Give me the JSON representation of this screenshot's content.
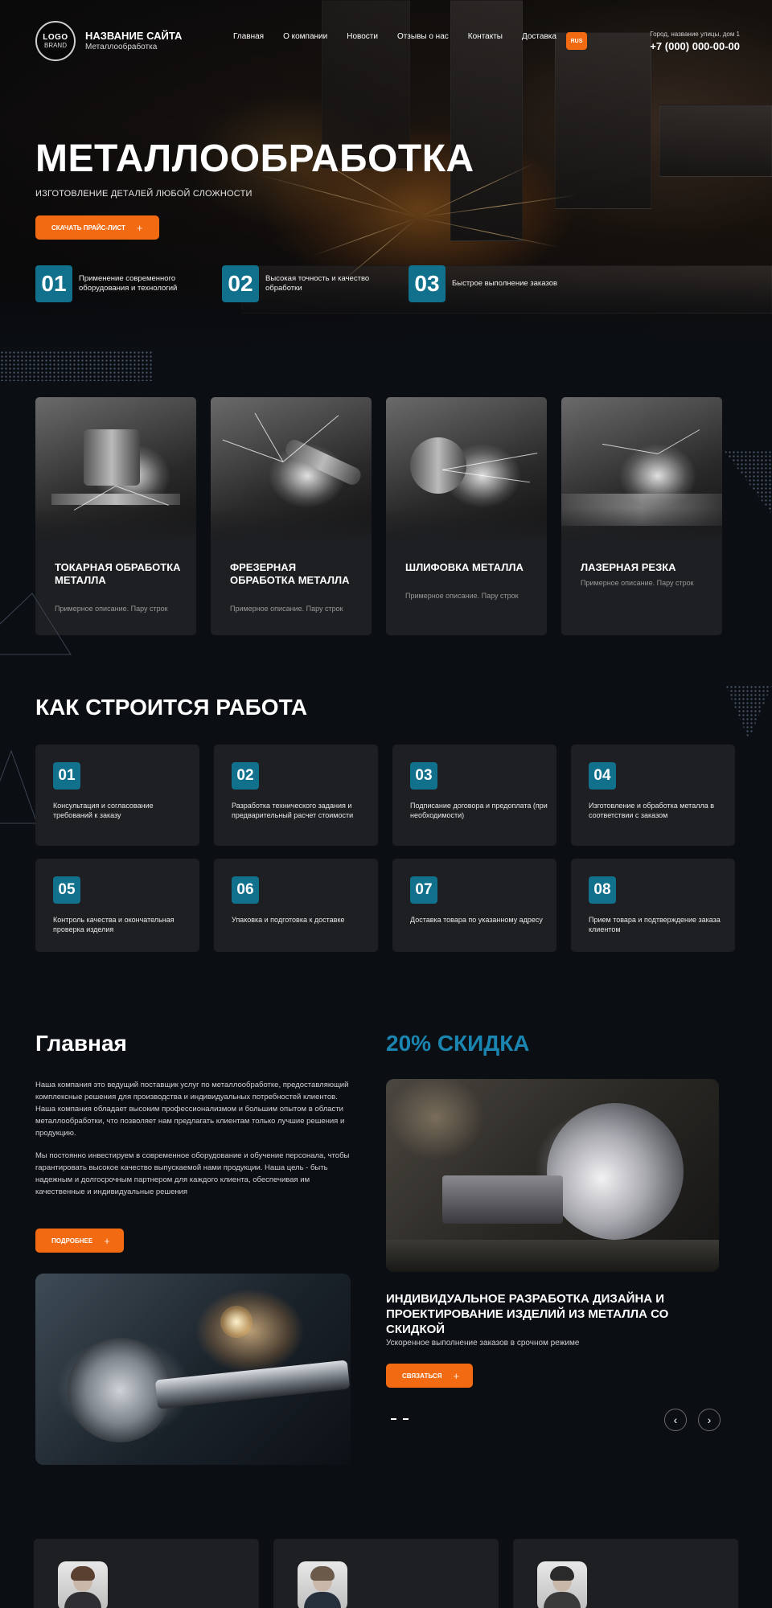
{
  "header": {
    "logo_line1": "LOGO",
    "logo_line2": "BRAND",
    "site_title": "НАЗВАНИЕ САЙТА",
    "site_subtitle": "Металлообработка",
    "nav": [
      "Главная",
      "О компании",
      "Новости",
      "Отзывы о нас",
      "Контакты",
      "Доставка"
    ],
    "lang_button": "RUS",
    "address": "Город, название улицы, дом 1",
    "phone": "+7 (000) 000-00-00"
  },
  "hero": {
    "title": "МЕТАЛЛООБРАБОТКА",
    "subtitle": "ИЗГОТОВЛЕНИЕ ДЕТАЛЕЙ ЛЮБОЙ СЛОЖНОСТИ",
    "button": "СКАЧАТЬ ПРАЙС-ЛИСТ",
    "features": [
      {
        "num": "01",
        "text": "Применение современного оборудования и технологий"
      },
      {
        "num": "02",
        "text": "Высокая точность и качество обработки"
      },
      {
        "num": "03",
        "text": "Быстрое выполнение заказов"
      }
    ]
  },
  "services": [
    {
      "name": "ТОКАРНАЯ ОБРАБОТКА МЕТАЛЛА",
      "desc": "Примерное описание. Пару строк"
    },
    {
      "name": "ФРЕЗЕРНАЯ ОБРАБОТКА МЕТАЛЛА",
      "desc": "Примерное описание. Пару строк"
    },
    {
      "name": "ШЛИФОВКА МЕТАЛЛА",
      "desc": "Примерное описание. Пару строк"
    },
    {
      "name": "ЛАЗЕРНАЯ РЕЗКА",
      "desc": "Примерное описание. Пару строк"
    }
  ],
  "process": {
    "title": "КАК СТРОИТСЯ РАБОТА",
    "steps": [
      {
        "num": "01",
        "text": "Консультация и согласование требований к заказу"
      },
      {
        "num": "02",
        "text": "Разработка технического задания и предварительный расчет стоимости"
      },
      {
        "num": "03",
        "text": "Подписание договора и предоплата (при необходимости)"
      },
      {
        "num": "04",
        "text": "Изготовление и обработка металла в соответствии с заказом"
      },
      {
        "num": "05",
        "text": "Контроль качества и окончательная проверка изделия"
      },
      {
        "num": "06",
        "text": "Упаковка и подготовка к доставке"
      },
      {
        "num": "07",
        "text": "Доставка товара по указанному адресу"
      },
      {
        "num": "08",
        "text": "Прием товара и подтверждение заказа клиентом"
      }
    ]
  },
  "about": {
    "title": "Главная",
    "paragraph1": "Наша компания это ведущий поставщик услуг по металлообработке, предоставляющий комплексные решения для производства и индивидуальных потребностей клиентов. Наша компания обладает высоким профессионализмом и большим опытом в области металлообработки, что позволяет нам предлагать клиентам только лучшие решения и продукцию.",
    "paragraph2": "Мы постоянно инвестируем в современное оборудование и обучение персонала, чтобы гарантировать высокое качество выпускаемой нами продукции. Наша цель - быть надежным и долгосрочным партнером для каждого клиента, обеспечивая им качественные и индивидуальные решения",
    "button": "ПОДРОБНЕЕ"
  },
  "discount": {
    "title": "20% СКИДКА",
    "heading": "ИНДИВИДУАЛЬНОЕ РАЗРАБОТКА ДИЗАЙНА И ПРОЕКТИРОВАНИЕ ИЗДЕЛИЙ ИЗ МЕТАЛЛА СО СКИДКОЙ",
    "subtitle": "Ускоренное выполнение заказов в срочном режиме",
    "button": "СВЯЗАТЬСЯ",
    "prev": "‹",
    "next": "›"
  },
  "colors": {
    "accent": "#f26a11",
    "teal": "#11708c",
    "discount_blue": "#1a85b1",
    "background": "#0b0e13",
    "card": "#1e1f22"
  }
}
